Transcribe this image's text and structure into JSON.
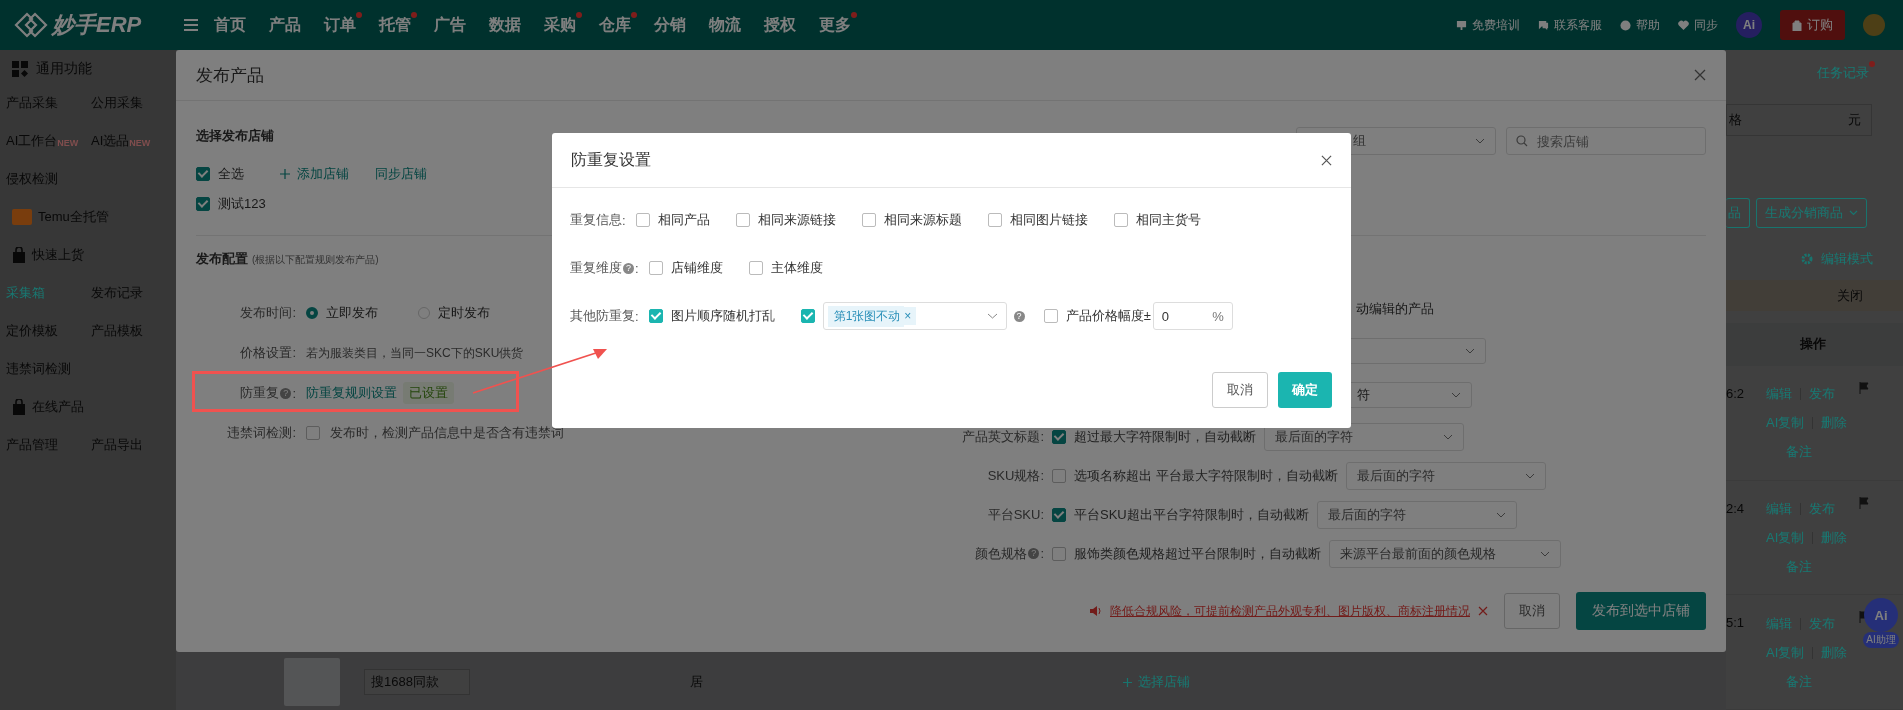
{
  "topbar": {
    "logo": "妙手ERP",
    "nav": [
      {
        "label": "首页",
        "dot": false
      },
      {
        "label": "产品",
        "dot": false
      },
      {
        "label": "订单",
        "dot": true
      },
      {
        "label": "托管",
        "dot": true
      },
      {
        "label": "广告",
        "dot": false
      },
      {
        "label": "数据",
        "dot": false
      },
      {
        "label": "采购",
        "dot": true
      },
      {
        "label": "仓库",
        "dot": true
      },
      {
        "label": "分销",
        "dot": false
      },
      {
        "label": "物流",
        "dot": false
      },
      {
        "label": "授权",
        "dot": false
      },
      {
        "label": "更多",
        "dot": true
      }
    ],
    "tools": [
      {
        "kind": "training",
        "label": "免费培训"
      },
      {
        "kind": "chat",
        "label": "联系客服"
      },
      {
        "kind": "help",
        "label": "帮助"
      },
      {
        "kind": "sync",
        "label": "同步"
      }
    ],
    "ai_badge": "Ai",
    "order_button": "订购"
  },
  "sidebar": {
    "section": "通用功能",
    "rows": [
      [
        {
          "kind": "text",
          "label": "产品采集",
          "selected": false
        },
        {
          "kind": "text",
          "label": "公用采集",
          "selected": false
        }
      ],
      [
        {
          "kind": "text",
          "label": "AI工作台",
          "badge": "NEW",
          "selected": false
        },
        {
          "kind": "text",
          "label": "AI选品",
          "badge": "NEW",
          "selected": false
        }
      ],
      [
        {
          "kind": "text",
          "label": "侵权检测",
          "selected": false
        }
      ],
      [
        {
          "kind": "temu",
          "label": "Temu全托管",
          "selected": false
        }
      ],
      [
        {
          "kind": "bag",
          "label": "快速上货",
          "selected": false
        }
      ],
      [
        {
          "kind": "text",
          "label": "采集箱",
          "selected": true
        },
        {
          "kind": "text",
          "label": "发布记录",
          "selected": false
        }
      ],
      [
        {
          "kind": "text",
          "label": "定价模板",
          "selected": false
        },
        {
          "kind": "text",
          "label": "产品模板",
          "selected": false
        }
      ],
      [
        {
          "kind": "text",
          "label": "违禁词检测",
          "selected": false
        }
      ],
      [
        {
          "kind": "bag",
          "label": "在线产品",
          "selected": false
        }
      ],
      [
        {
          "kind": "text",
          "label": "产品管理",
          "selected": false
        },
        {
          "kind": "text",
          "label": "产品导出",
          "selected": false
        }
      ]
    ]
  },
  "main": {
    "task_record": "任务记录",
    "price_fragment": "格",
    "price_unit": "元",
    "button_fragment": "品",
    "generate_button": "生成分销商品",
    "edit_mode": "编辑模式",
    "close_label": "关闭",
    "ops_header": "操作",
    "rows": [
      {
        "time": "6:2",
        "actions": [
          "编辑",
          "发布",
          "AI复制",
          "删除",
          "备注"
        ]
      },
      {
        "time": "2:4",
        "actions": [
          "编辑",
          "发布",
          "AI复制",
          "删除",
          "备注"
        ]
      },
      {
        "time": "5:1",
        "actions": [
          "编辑",
          "发布",
          "AI复制",
          "删除",
          "备注"
        ]
      }
    ],
    "same_search": "搜1688同款",
    "column_fragment": "居",
    "choose_store": "选择店铺",
    "ai_badge": "Ai",
    "ai_assistant": "AI助理"
  },
  "publish_dialog": {
    "title": "发布产品",
    "store_section": "选择发布店铺",
    "select_all": {
      "label": "全选",
      "checked": true
    },
    "add_store": "添加店铺",
    "sync_store": "同步店铺",
    "stores": [
      {
        "name": "测试123",
        "checked": true
      }
    ],
    "group_fragment": "组",
    "store_search_placeholder": "搜索店铺",
    "config_title": "发布配置",
    "config_hint": "(根据以下配置规则发布产品)",
    "publish_time": {
      "label": "发布时间:",
      "options": [
        {
          "label": "立即发布",
          "selected": true
        },
        {
          "label": "定时发布",
          "selected": false
        }
      ]
    },
    "price": {
      "label": "价格设置:",
      "text": "若为服装类目，当同一SKC下的SKU供货"
    },
    "dedup": {
      "label": "防重复",
      "help": "?",
      "suffix": ":",
      "link": "防重复规则设置",
      "status": "已设置"
    },
    "banned": {
      "label": "违禁词检测:",
      "checked": false,
      "text": "发布时，检测产品信息中是否含有违禁词"
    },
    "auto_edit_fragment": "动编辑的产品",
    "select_fragment": "符",
    "truncation": [
      {
        "label": "产品英文标题",
        "suffix": ":",
        "checked": true,
        "text": "超过最大字符限制时，自动截断",
        "select": "最后面的字符"
      },
      {
        "label": "SKU规格",
        "suffix": ":",
        "checked": false,
        "text": "选项名称超出 平台最大字符限制时，自动截断",
        "select": "最后面的字符"
      },
      {
        "label": "平台SKU",
        "suffix": ":",
        "checked": true,
        "text": "平台SKU超出平台字符限制时，自动截断",
        "select": "最后面的字符"
      },
      {
        "label": "颜色规格",
        "help": "?",
        "suffix": ":",
        "checked": false,
        "text": "服饰类颜色规格超过平台限制时，自动截断",
        "select": "来源平台最前面的颜色规格"
      }
    ],
    "warning_link": "降低合规风险，可提前检测产品外观专利、图片版权、商标注册情况",
    "cancel": "取消",
    "submit": "发布到选中店铺"
  },
  "dedup_modal": {
    "title": "防重复设置",
    "rows": [
      {
        "kind": "checks",
        "label": "重复信息",
        "suffix": ":",
        "options": [
          {
            "label": "相同产品",
            "checked": false
          },
          {
            "label": "相同来源链接",
            "checked": false
          },
          {
            "label": "相同来源标题",
            "checked": false
          },
          {
            "label": "相同图片链接",
            "checked": false
          },
          {
            "label": "相同主货号",
            "checked": false
          }
        ]
      },
      {
        "kind": "checks",
        "label": "重复维度",
        "help": "?",
        "suffix": ":",
        "options": [
          {
            "label": "店铺维度",
            "checked": false
          },
          {
            "label": "主体维度",
            "checked": false
          }
        ]
      },
      {
        "kind": "other",
        "label": "其他防重复",
        "suffix": ":",
        "shuffle": {
          "label": "图片顺序随机打乱",
          "checked": true
        },
        "keep": {
          "checked": true,
          "tag": "第1张图不动",
          "tag_close": "×",
          "help": "?"
        },
        "price_range": {
          "label": "产品价格幅度±",
          "checked": false,
          "value": "0",
          "unit": "%"
        }
      }
    ],
    "cancel": "取消",
    "confirm": "确定"
  }
}
